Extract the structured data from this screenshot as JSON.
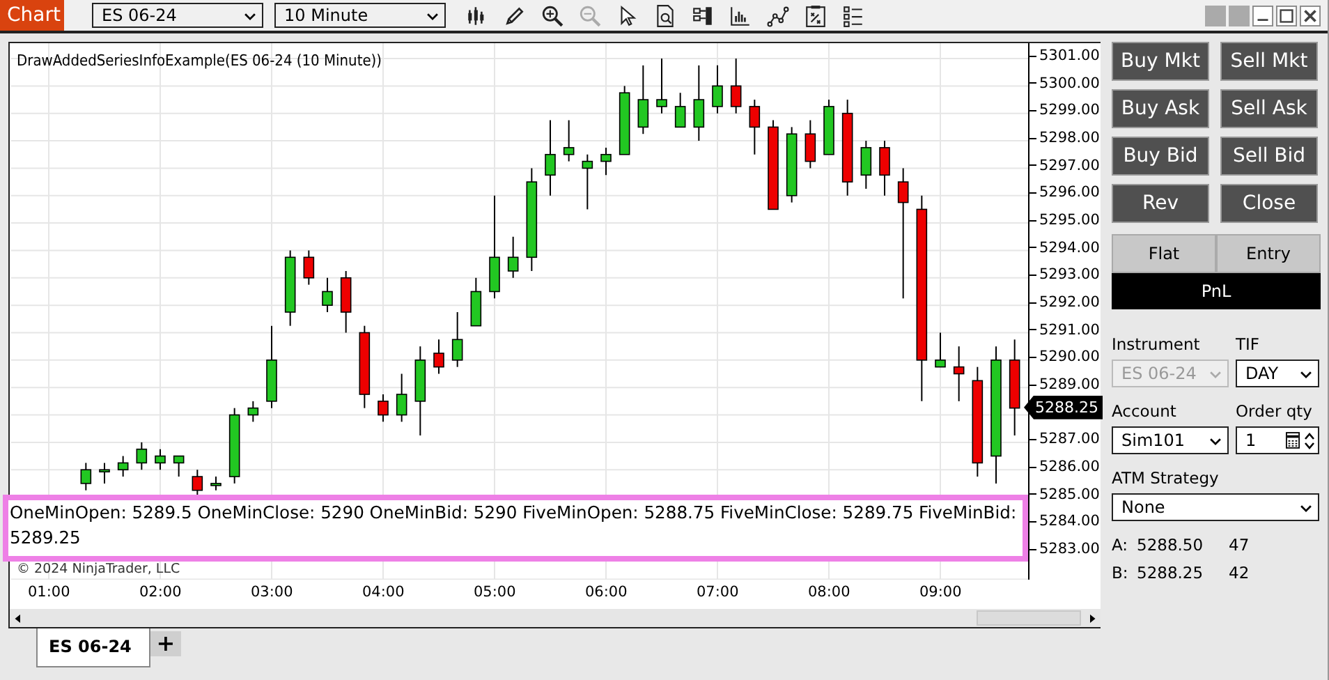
{
  "window": {
    "title": "Chart"
  },
  "toolbar": {
    "instrument": "ES 06-24",
    "interval": "10 Minute"
  },
  "chart": {
    "title": "DrawAddedSeriesInfoExample(ES 06-24 (10 Minute))",
    "last_price": "5288.25",
    "info_text": "OneMinOpen: 5289.5 OneMinClose: 5290 OneMinBid: 5290 FiveMinOpen: 5288.75 FiveMinClose: 5289.75 FiveMinBid: 5289.25",
    "copyright": "© 2024 NinjaTrader, LLC",
    "chart_data": {
      "type": "candlestick",
      "grid": true,
      "xlim": [
        39.75,
        587.25
      ],
      "ylim": [
        5281.99,
        5301.56
      ],
      "x": [
        80,
        90,
        100,
        110,
        120,
        130,
        140,
        150,
        160,
        170,
        180,
        190,
        200,
        210,
        220,
        230,
        240,
        250,
        260,
        270,
        280,
        290,
        300,
        310,
        320,
        330,
        340,
        350,
        360,
        370,
        380,
        390,
        400,
        410,
        420,
        430,
        440,
        450,
        460,
        470,
        480,
        490,
        500,
        510,
        520,
        530,
        540,
        550,
        560,
        570,
        580
      ],
      "xticks": [
        {
          "value": 60,
          "label": "01:00"
        },
        {
          "value": 120,
          "label": "02:00"
        },
        {
          "value": 180,
          "label": "03:00"
        },
        {
          "value": 240,
          "label": "04:00"
        },
        {
          "value": 300,
          "label": "05:00"
        },
        {
          "value": 360,
          "label": "06:00"
        },
        {
          "value": 420,
          "label": "07:00"
        },
        {
          "value": 480,
          "label": "08:00"
        },
        {
          "value": 540,
          "label": "09:00"
        }
      ],
      "yticks": [
        {
          "value": 5301,
          "label": "5301.00"
        },
        {
          "value": 5300,
          "label": "5300.00"
        },
        {
          "value": 5299,
          "label": "5299.00"
        },
        {
          "value": 5298,
          "label": "5298.00"
        },
        {
          "value": 5297,
          "label": "5297.00"
        },
        {
          "value": 5296,
          "label": "5296.00"
        },
        {
          "value": 5295,
          "label": "5295.00"
        },
        {
          "value": 5294,
          "label": "5294.00"
        },
        {
          "value": 5293,
          "label": "5293.00"
        },
        {
          "value": 5292,
          "label": "5292.00"
        },
        {
          "value": 5291,
          "label": "5291.00"
        },
        {
          "value": 5290,
          "label": "5290.00"
        },
        {
          "value": 5289,
          "label": "5289.00"
        },
        {
          "value": 5287,
          "label": "5287.00"
        },
        {
          "value": 5286,
          "label": "5286.00"
        },
        {
          "value": 5285,
          "label": "5285.00"
        },
        {
          "value": 5284,
          "label": "5284.00"
        },
        {
          "value": 5283,
          "label": "5283.00"
        }
      ],
      "ohlc": [
        [
          5285.5,
          5286.25,
          5285.25,
          5286
        ],
        [
          5286,
          5286.25,
          5285.5,
          5286
        ],
        [
          5286,
          5286.5,
          5285.75,
          5286.25
        ],
        [
          5286.25,
          5287,
          5286,
          5286.75
        ],
        [
          5286.25,
          5286.75,
          5286,
          5286.5
        ],
        [
          5286.25,
          5286.5,
          5285.75,
          5286.5
        ],
        [
          5285.75,
          5286,
          5285,
          5285.25
        ],
        [
          5285.5,
          5285.75,
          5285.25,
          5285.5
        ],
        [
          5285.75,
          5288.25,
          5285.5,
          5288
        ],
        [
          5288,
          5288.5,
          5287.75,
          5288.25
        ],
        [
          5288.5,
          5291.25,
          5288.25,
          5290
        ],
        [
          5291.75,
          5294,
          5291.25,
          5293.75
        ],
        [
          5293.75,
          5294,
          5292.75,
          5293
        ],
        [
          5292,
          5293,
          5291.75,
          5292.5
        ],
        [
          5293,
          5293.25,
          5291,
          5291.75
        ],
        [
          5291,
          5291.25,
          5288.25,
          5288.75
        ],
        [
          5288.5,
          5288.75,
          5287.75,
          5288
        ],
        [
          5288,
          5289.5,
          5287.75,
          5288.75
        ],
        [
          5288.5,
          5290.5,
          5287.25,
          5290
        ],
        [
          5290.25,
          5290.75,
          5289.5,
          5289.75
        ],
        [
          5290,
          5291.75,
          5289.75,
          5290.75
        ],
        [
          5291.25,
          5293,
          5291.25,
          5292.5
        ],
        [
          5292.5,
          5296,
          5292.25,
          5293.75
        ],
        [
          5293.25,
          5294.5,
          5293,
          5293.75
        ],
        [
          5293.75,
          5297,
          5293.25,
          5296.5
        ],
        [
          5296.75,
          5298.75,
          5296,
          5297.5
        ],
        [
          5297.5,
          5298.75,
          5297.25,
          5297.75
        ],
        [
          5297,
          5297.5,
          5295.5,
          5297.25
        ],
        [
          5297.25,
          5297.75,
          5296.75,
          5297.5
        ],
        [
          5297.5,
          5300,
          5297.5,
          5299.75
        ],
        [
          5298.5,
          5300.75,
          5298.25,
          5299.5
        ],
        [
          5299.25,
          5301,
          5299,
          5299.5
        ],
        [
          5298.5,
          5299.75,
          5298.5,
          5299.25
        ],
        [
          5298.5,
          5300.75,
          5298,
          5299.5
        ],
        [
          5299.25,
          5300.75,
          5299,
          5300
        ],
        [
          5300,
          5301,
          5299,
          5299.25
        ],
        [
          5299.25,
          5299.5,
          5297.5,
          5298.5
        ],
        [
          5298.5,
          5298.75,
          5295.5,
          5295.5
        ],
        [
          5296,
          5298.5,
          5295.75,
          5298.25
        ],
        [
          5298.25,
          5298.75,
          5297,
          5297.25
        ],
        [
          5297.5,
          5299.5,
          5297.5,
          5299.25
        ],
        [
          5299,
          5299.5,
          5296,
          5296.5
        ],
        [
          5296.75,
          5298,
          5296.25,
          5297.75
        ],
        [
          5297.75,
          5298,
          5296,
          5296.75
        ],
        [
          5296.5,
          5297,
          5292.25,
          5295.75
        ],
        [
          5295.5,
          5296,
          5288.5,
          5290
        ],
        [
          5289.75,
          5291,
          5289.75,
          5290
        ],
        [
          5289.75,
          5290.5,
          5288.5,
          5289.5
        ],
        [
          5289.25,
          5289.75,
          5285.75,
          5286.25
        ],
        [
          5286.5,
          5290.5,
          5285.5,
          5290
        ],
        [
          5290,
          5290.75,
          5287.25,
          5288.25
        ]
      ]
    }
  },
  "tabs": [
    {
      "label": "ES 06-24",
      "selected": true
    }
  ],
  "add_tab": "+",
  "order_buttons": [
    "Buy Mkt",
    "Sell Mkt",
    "Buy Ask",
    "Sell Ask",
    "Buy Bid",
    "Sell Bid",
    "Rev",
    "Close"
  ],
  "position": {
    "status": "Flat",
    "entry": "Entry",
    "pnl": "PnL"
  },
  "form": {
    "instrument_label": "Instrument",
    "instrument": "ES 06-24",
    "instrument_disabled": true,
    "tif_label": "TIF",
    "tif": "DAY",
    "account_label": "Account",
    "account": "Sim101",
    "qty_label": "Order qty",
    "qty": "1",
    "atm_label": "ATM Strategy",
    "atm": "None"
  },
  "quotes": [
    {
      "side": "A:",
      "price": "5288.50",
      "size": "47"
    },
    {
      "side": "B:",
      "price": "5288.25",
      "size": "42"
    }
  ]
}
